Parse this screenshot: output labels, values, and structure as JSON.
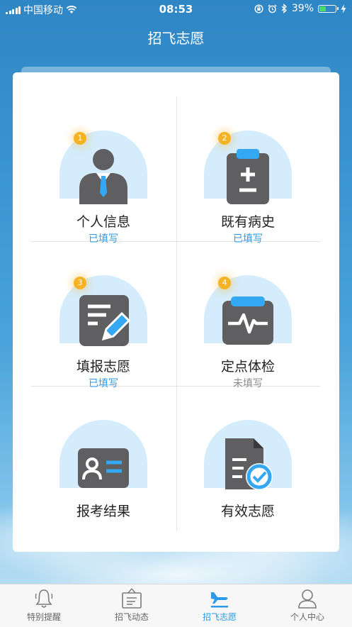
{
  "status_bar": {
    "carrier": "中国移动",
    "time": "08:53",
    "battery_percent": "39%",
    "icons": [
      "signal-icon",
      "wifi-icon",
      "orientation-lock-icon",
      "alarm-icon",
      "bluetooth-icon",
      "battery-icon",
      "charging-icon"
    ]
  },
  "header": {
    "title": "招飞志愿"
  },
  "grid": {
    "items": [
      {
        "label": "个人信息",
        "status": "已填写",
        "badge": "1",
        "icon": "person-icon"
      },
      {
        "label": "既有病史",
        "status": "已填写",
        "badge": "2",
        "icon": "medical-record-icon"
      },
      {
        "label": "填报志愿",
        "status": "已填写",
        "badge": "3",
        "icon": "edit-form-icon"
      },
      {
        "label": "定点体检",
        "status": "未填写",
        "badge": "4",
        "icon": "heartbeat-icon"
      },
      {
        "label": "报考结果",
        "status": "",
        "badge": "",
        "icon": "id-card-icon"
      },
      {
        "label": "有效志愿",
        "status": "",
        "badge": "",
        "icon": "verified-document-icon"
      }
    ]
  },
  "tabbar": {
    "tabs": [
      {
        "label": "特别提醒",
        "icon": "bell-icon"
      },
      {
        "label": "招飞动态",
        "icon": "news-board-icon"
      },
      {
        "label": "招飞志愿",
        "icon": "airplane-icon",
        "active": true
      },
      {
        "label": "个人中心",
        "icon": "user-icon"
      }
    ]
  },
  "colors": {
    "accent": "#2b9ae8",
    "icon_dark": "#5f5f62",
    "icon_light_bg": "#d4ecfb",
    "badge": "#f5b324",
    "icon_accent": "#35a8f3"
  }
}
